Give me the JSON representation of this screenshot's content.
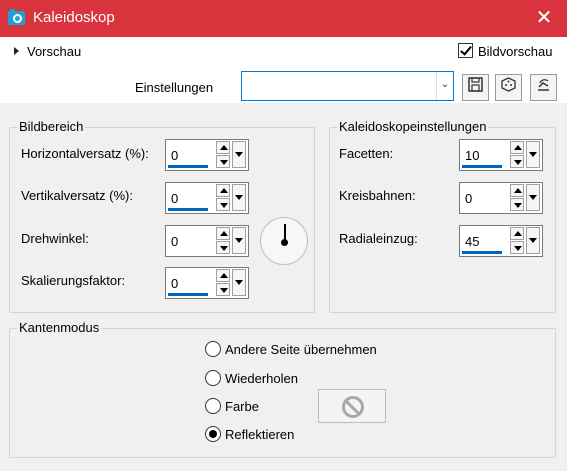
{
  "window": {
    "title": "Kaleidoskop",
    "close_glyph": "✕"
  },
  "top": {
    "preview_label": "Vorschau",
    "preview_checkbox_label": "Bildvorschau",
    "preview_checked": true,
    "settings_label": "Einstellungen",
    "settings_value": ""
  },
  "icons": {
    "save": "save-icon",
    "random": "dice-icon",
    "reset": "reset-icon"
  },
  "bildbereich": {
    "title": "Bildbereich",
    "fields": [
      {
        "label": "Horizontalversatz (%):",
        "value": "0"
      },
      {
        "label": "Vertikalversatz (%):",
        "value": "0"
      },
      {
        "label": "Drehwinkel:",
        "value": "0"
      },
      {
        "label": "Skalierungsfaktor:",
        "value": "0"
      }
    ]
  },
  "kaleidoskop": {
    "title": "Kaleidoskopeinstellungen",
    "fields": [
      {
        "label": "Facetten:",
        "value": "10"
      },
      {
        "label": "Kreisbahnen:",
        "value": "0"
      },
      {
        "label": "Radialeinzug:",
        "value": "45"
      }
    ]
  },
  "kantenmodus": {
    "title": "Kantenmodus",
    "options": [
      {
        "label": "Andere Seite übernehmen",
        "checked": false
      },
      {
        "label": "Wiederholen",
        "checked": false
      },
      {
        "label": "Farbe",
        "checked": false
      },
      {
        "label": "Reflektieren",
        "checked": true
      }
    ]
  }
}
